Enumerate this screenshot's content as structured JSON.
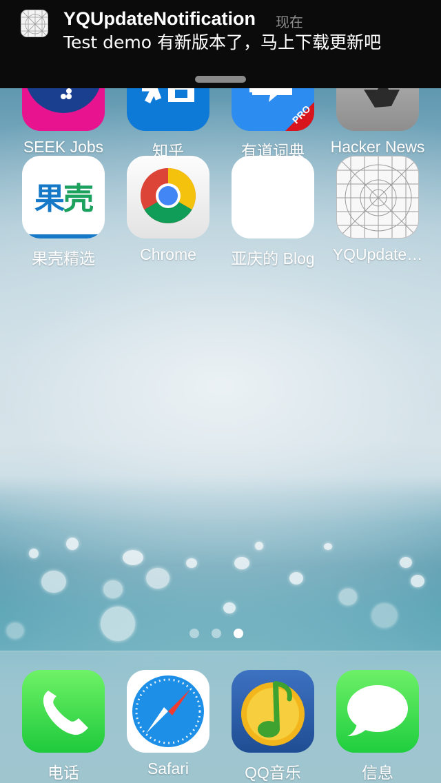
{
  "notification": {
    "app_name": "YQUpdateNotification",
    "time": "现在",
    "message": "Test demo 有新版本了，马上下载更新吧"
  },
  "home_rows": [
    [
      {
        "label": "SEEK Jobs",
        "icon": "seek-jobs-icon"
      },
      {
        "label": "知乎",
        "icon": "zhihu-icon"
      },
      {
        "label": "有道词典",
        "icon": "youdao-dictionary-icon"
      },
      {
        "label": "Hacker News",
        "icon": "hacker-news-icon"
      }
    ],
    [
      {
        "label": "果壳精选",
        "icon": "guokr-icon",
        "icon_text": "果壳"
      },
      {
        "label": "Chrome",
        "icon": "chrome-icon"
      },
      {
        "label": "亚庆的 Blog",
        "icon": "blank-white-icon"
      },
      {
        "label": "YQUpdate…",
        "icon": "placeholder-grid-icon"
      }
    ]
  ],
  "youdao_badge": "PRO",
  "page_indicator": {
    "total": 3,
    "current": 3
  },
  "dock": [
    {
      "label": "电话",
      "icon": "phone-icon"
    },
    {
      "label": "Safari",
      "icon": "safari-compass-icon"
    },
    {
      "label": "QQ音乐",
      "icon": "qq-music-note-icon"
    },
    {
      "label": "信息",
      "icon": "messages-bubble-icon"
    }
  ],
  "colors": {
    "seek": "#e8138f",
    "zhihu": "#0e7ad8",
    "youdao": "#2d8cf0",
    "hacker_news": "#9e9e9e",
    "guokr_blue": "#1679c8",
    "guokr_green": "#1ca25b",
    "phone_green": "#2cd24a",
    "messages_green": "#2fd94b",
    "qq_blue": "#2f5fa8",
    "qq_gold": "#f2b51b"
  }
}
